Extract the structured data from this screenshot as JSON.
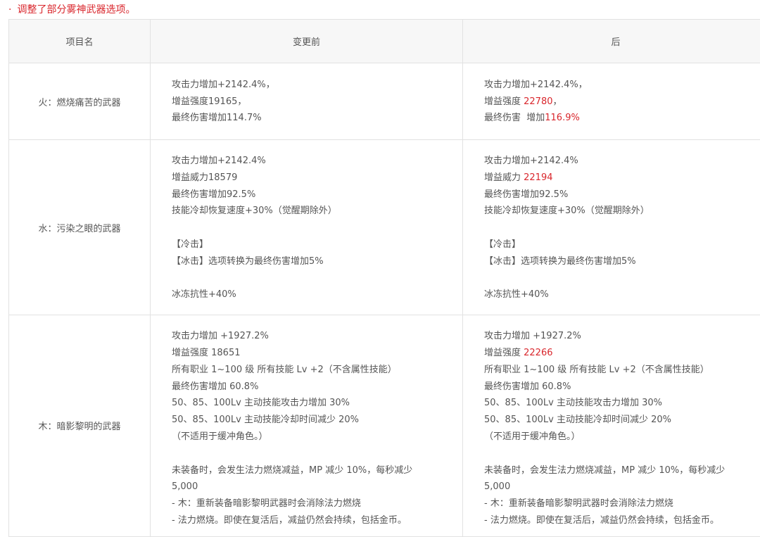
{
  "notice": {
    "bullet": "·",
    "text": "调整了部分雾神武器选项。"
  },
  "table": {
    "headers": [
      "项目名",
      "变更前",
      "后"
    ],
    "rows": [
      {
        "name": "火：燃烧痛苦的武器",
        "before": [
          "攻击力增加+2142.4%，",
          "增益强度19165，",
          "最终伤害增加114.7%"
        ],
        "after": [
          [
            {
              "t": "攻击力增加+2142.4%，"
            }
          ],
          [
            {
              "t": "增益强度 "
            },
            {
              "t": "22780",
              "red": true
            },
            {
              "t": "，"
            }
          ],
          [
            {
              "t": "最终伤害  增加"
            },
            {
              "t": "116.9%",
              "red": true
            }
          ]
        ]
      },
      {
        "name": "水：污染之眼的武器",
        "before": [
          "攻击力增加+2142.4%",
          "增益威力18579",
          "最终伤害增加92.5%",
          "技能冷却恢复速度+30%（觉醒期除外）",
          "",
          "【冷击】",
          "【冰击】选项转换为最终伤害增加5%",
          "",
          "冰冻抗性+40%"
        ],
        "after": [
          [
            {
              "t": "攻击力增加+2142.4%"
            }
          ],
          [
            {
              "t": "增益威力 "
            },
            {
              "t": "22194",
              "red": true
            }
          ],
          [
            {
              "t": "最终伤害增加92.5%"
            }
          ],
          [
            {
              "t": "技能冷却恢复速度+30%（觉醒期除外）"
            }
          ],
          [
            {
              "t": ""
            }
          ],
          [
            {
              "t": "【冷击】"
            }
          ],
          [
            {
              "t": "【冰击】选项转换为最终伤害增加5%"
            }
          ],
          [
            {
              "t": ""
            }
          ],
          [
            {
              "t": "冰冻抗性+40%"
            }
          ]
        ]
      },
      {
        "name": "木：暗影黎明的武器",
        "before": [
          "攻击力增加 +1927.2%",
          "增益强度 18651",
          "所有职业 1~100 级 所有技能 Lv +2（不含属性技能）",
          "最终伤害增加 60.8%",
          "50、85、100Lv 主动技能攻击力增加 30%",
          "50、85、100Lv 主动技能冷却时间减少 20%",
          "（不适用于缓冲角色。）",
          "",
          "未装备时，会发生法力燃烧减益，MP 减少 10%，每秒减少",
          "5,000",
          "- 木：重新装备暗影黎明武器时会消除法力燃烧",
          "- 法力燃烧。即使在复活后，减益仍然会持续，包括金币。"
        ],
        "after": [
          [
            {
              "t": "攻击力增加 +1927.2%"
            }
          ],
          [
            {
              "t": "增益强度 "
            },
            {
              "t": "22266",
              "red": true
            }
          ],
          [
            {
              "t": "所有职业 1~100 级 所有技能 Lv +2（不含属性技能）"
            }
          ],
          [
            {
              "t": "最终伤害增加 60.8%"
            }
          ],
          [
            {
              "t": "50、85、100Lv 主动技能攻击力增加 30%"
            }
          ],
          [
            {
              "t": "50、85、100Lv 主动技能冷却时间减少 20%"
            }
          ],
          [
            {
              "t": "（不适用于缓冲角色。）"
            }
          ],
          [
            {
              "t": ""
            }
          ],
          [
            {
              "t": "未装备时，会发生法力燃烧减益，MP 减少 10%，每秒减少"
            }
          ],
          [
            {
              "t": "5,000"
            }
          ],
          [
            {
              "t": "- 木：重新装备暗影黎明武器时会消除法力燃烧"
            }
          ],
          [
            {
              "t": "- 法力燃烧。即使在复活后，减益仍然会持续，包括金币。"
            }
          ]
        ]
      }
    ]
  }
}
